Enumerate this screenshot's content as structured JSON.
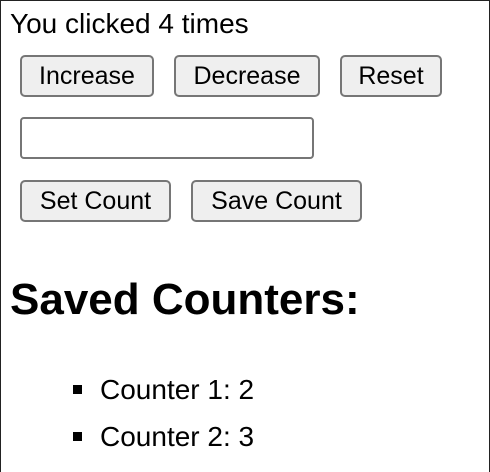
{
  "counter": {
    "text": "You clicked 4 times"
  },
  "buttons": {
    "increase": "Increase",
    "decrease": "Decrease",
    "reset": "Reset",
    "set_count": "Set Count",
    "save_count": "Save Count"
  },
  "count_input": {
    "value": "",
    "placeholder": ""
  },
  "saved": {
    "title": "Saved Counters:",
    "items": [
      {
        "label": "Counter 1: 2"
      },
      {
        "label": "Counter 2: 3"
      }
    ]
  }
}
